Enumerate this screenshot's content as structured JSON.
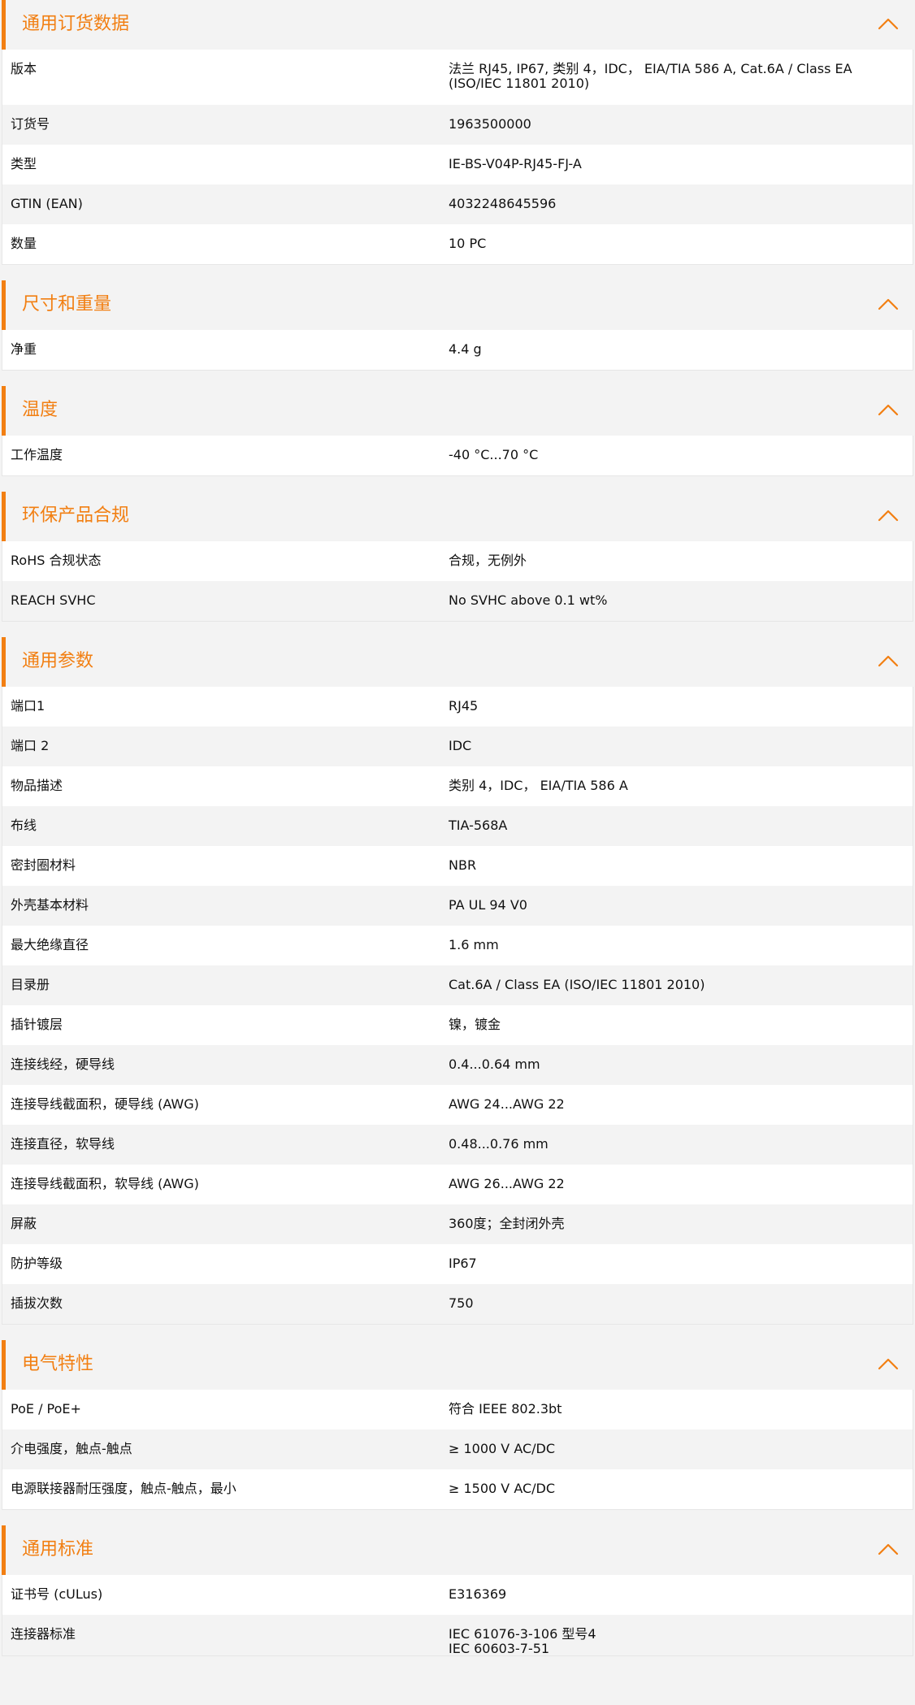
{
  "colors": {
    "accent": "#f27f12",
    "row_alt": "#f3f3f3",
    "row": "#ffffff"
  },
  "icons": {
    "collapse": "chevron-up-icon"
  },
  "sections": [
    {
      "id": "ordering",
      "title": "通用订货数据",
      "rows": [
        {
          "label": "版本",
          "value": [
            "法兰 RJ45, IP67, 类别 4，IDC， EIA/TIA 586 A, Cat.6A / Class EA",
            "(ISO/IEC 11801 2010)"
          ]
        },
        {
          "label": "订货号",
          "value": [
            "1963500000"
          ]
        },
        {
          "label": "类型",
          "value": [
            "IE-BS-V04P-RJ45-FJ-A"
          ]
        },
        {
          "label": "GTIN (EAN)",
          "value": [
            "4032248645596"
          ]
        },
        {
          "label": "数量",
          "value": [
            "10  PC"
          ]
        }
      ]
    },
    {
      "id": "dimensions",
      "title": "尺寸和重量",
      "rows": [
        {
          "label": "净重",
          "value": [
            "4.4  g"
          ]
        }
      ]
    },
    {
      "id": "temperature",
      "title": "温度",
      "rows": [
        {
          "label": "工作温度",
          "value": [
            "-40 °C...70 °C"
          ]
        }
      ]
    },
    {
      "id": "environmental",
      "title": "环保产品合规",
      "rows": [
        {
          "label": "RoHS 合规状态",
          "value": [
            "合规，无例外"
          ]
        },
        {
          "label": "REACH SVHC",
          "value": [
            "No SVHC above 0.1 wt%"
          ]
        }
      ]
    },
    {
      "id": "general",
      "title": "通用参数",
      "rows": [
        {
          "label": "端口1",
          "value": [
            "RJ45"
          ]
        },
        {
          "label": "端口 2",
          "value": [
            "IDC"
          ]
        },
        {
          "label": "物品描述",
          "value": [
            "类别 4，IDC， EIA/TIA 586 A"
          ]
        },
        {
          "label": "布线",
          "value": [
            "TIA-568A"
          ]
        },
        {
          "label": "密封圈材料",
          "value": [
            "NBR"
          ]
        },
        {
          "label": "外壳基本材料",
          "value": [
            "PA UL 94 V0"
          ]
        },
        {
          "label": "最大绝缘直径",
          "value": [
            "1.6  mm"
          ]
        },
        {
          "label": "目录册",
          "value": [
            "Cat.6A / Class EA (ISO/IEC 11801 2010)"
          ]
        },
        {
          "label": "插针镀层",
          "value": [
            "镍，镀金"
          ]
        },
        {
          "label": "连接线经，硬导线",
          "value": [
            "0.4...0.64 mm"
          ]
        },
        {
          "label": "连接导线截面积，硬导线 (AWG)",
          "value": [
            "AWG 24...AWG 22"
          ]
        },
        {
          "label": "连接直径，软导线",
          "value": [
            "0.48...0.76 mm"
          ]
        },
        {
          "label": "连接导线截面积，软导线 (AWG)",
          "value": [
            "AWG 26...AWG 22"
          ]
        },
        {
          "label": "屏蔽",
          "value": [
            "360度；全封闭外壳"
          ]
        },
        {
          "label": "防护等级",
          "value": [
            "IP67"
          ]
        },
        {
          "label": "插拔次数",
          "value": [
            "750"
          ]
        }
      ]
    },
    {
      "id": "electrical",
      "title": "电气特性",
      "rows": [
        {
          "label": "PoE / PoE+",
          "value": [
            "符合 IEEE 802.3bt"
          ]
        },
        {
          "label": "介电强度，触点-触点",
          "value": [
            "≥ 1000 V AC/DC"
          ]
        },
        {
          "label": "电源联接器耐压强度，触点-触点，最小",
          "value": [
            "≥ 1500 V AC/DC"
          ]
        }
      ]
    },
    {
      "id": "standards",
      "title": "通用标准",
      "rows": [
        {
          "label": "证书号 (cULus)",
          "value": [
            "E316369"
          ]
        },
        {
          "label": "连接器标准",
          "value": [
            "IEC 61076-3-106 型号4",
            "IEC 60603-7-51"
          ]
        }
      ]
    }
  ]
}
